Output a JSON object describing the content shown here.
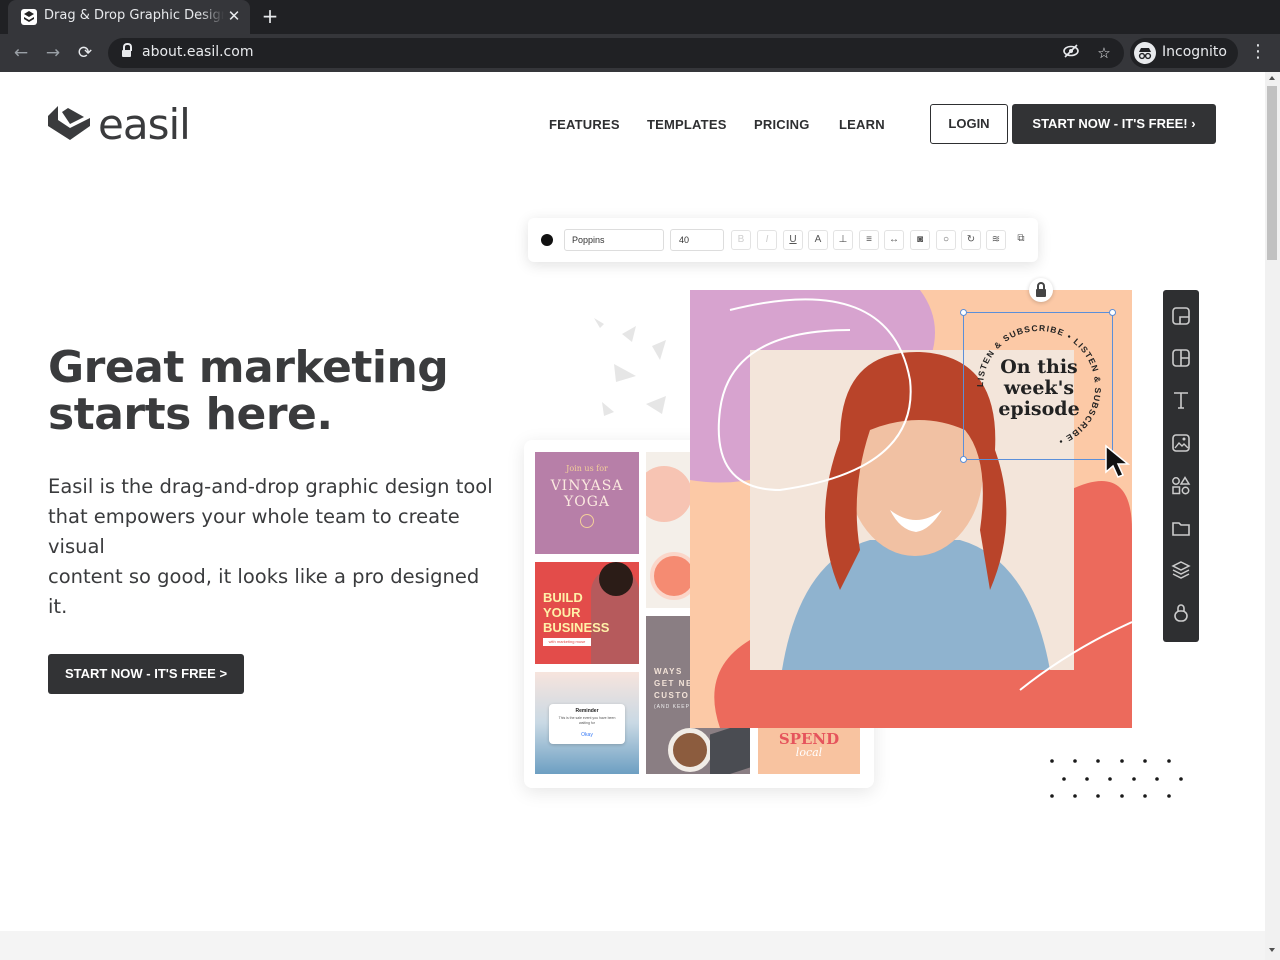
{
  "browser": {
    "tab_title": "Drag & Drop Graphic Design",
    "tab_close": "✕",
    "new_tab": "+",
    "back": "←",
    "forward": "→",
    "reload": "⟳",
    "url": "about.easil.com",
    "incognito_label": "Incognito",
    "menu": "⋮",
    "star": "☆"
  },
  "site": {
    "logo_text": "easil",
    "nav": [
      "FEATURES",
      "TEMPLATES",
      "PRICING",
      "LEARN"
    ],
    "login_label": "LOGIN",
    "start_top_label": "START NOW - IT'S FREE! ›",
    "hero_title_line1": "Great marketing",
    "hero_title_line2": "starts here.",
    "hero_sub_lines": [
      "Easil is the drag-and-drop graphic design tool",
      "that empowers your whole team to create",
      "visual",
      "content so good, it looks like a pro designed",
      "it."
    ],
    "start_hero_label": "START NOW - IT'S FREE >"
  },
  "illustration": {
    "font_name": "Poppins",
    "font_size": "40",
    "toolbar_buttons": [
      "B",
      "I",
      "U",
      "A",
      "⊥",
      "≡",
      "↔",
      "◙",
      "○",
      "↻",
      "≋",
      "⧉"
    ],
    "badge_lines": [
      "On this",
      "week's",
      "episode"
    ],
    "badge_ring": "LISTEN & SUBSCRIBE • LISTEN & SUBSCRIBE •",
    "thumbs": {
      "yoga_small": "Join us for",
      "yoga_big": "VINYASA YOGA",
      "build_lines": [
        "BUILD",
        "YOUR",
        "BUSINESS"
      ],
      "build_small": "with marketing muse",
      "reminder_title": "Reminder",
      "reminder_body": "This is the sale event you have been waiting for",
      "reminder_btn": "Okay",
      "ways_lines": [
        "WAYS",
        "GET NE",
        "CUSTO"
      ],
      "ways_small": "(AND KEEP",
      "spend_big": "SPEND",
      "spend_small": "local"
    },
    "colors": {
      "peach": "#fcc9a6",
      "coral": "#ec6a5c",
      "lavender": "#d7a3cf",
      "dark": "#2e2f31"
    }
  }
}
